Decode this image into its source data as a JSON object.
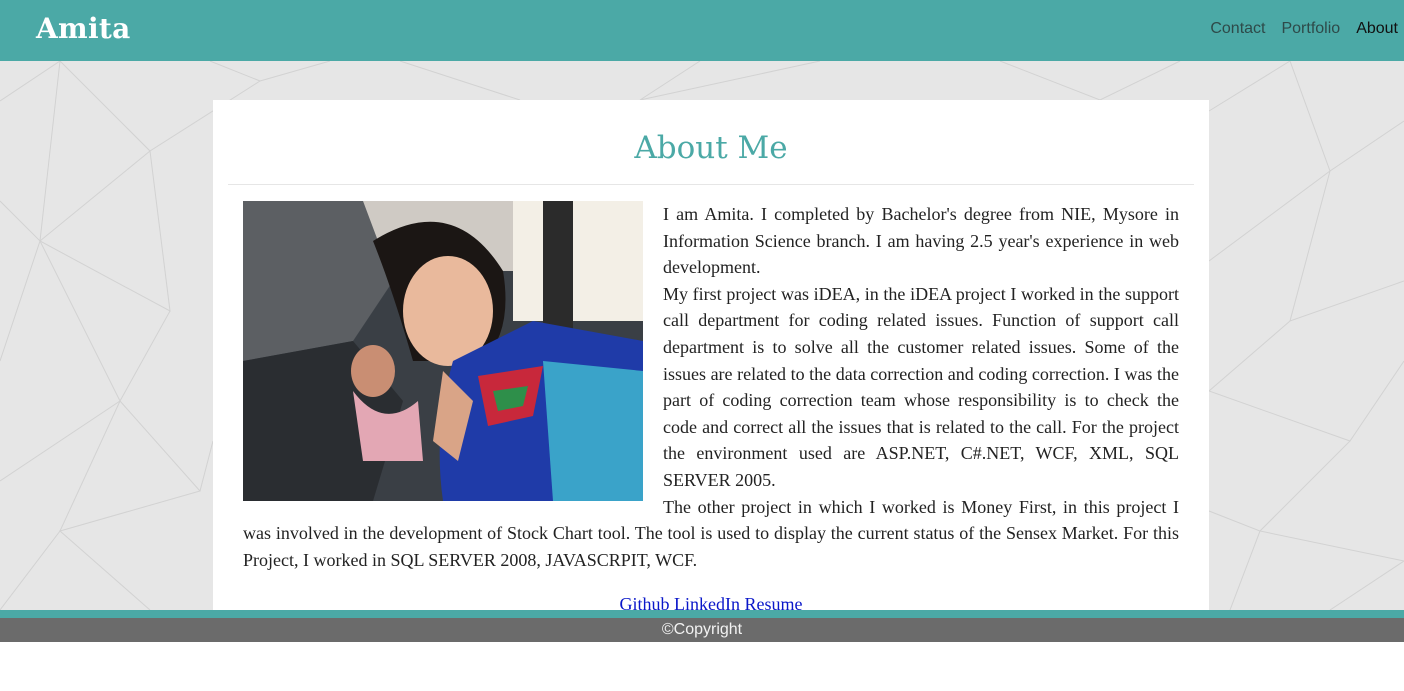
{
  "header": {
    "brand": "Amita",
    "nav": [
      {
        "label": "Contact"
      },
      {
        "label": "Portfolio"
      },
      {
        "label": "About"
      }
    ],
    "active_nav": "About"
  },
  "about": {
    "title": "About Me",
    "paragraphs": [
      "I am Amita. I completed by Bachelor's degree from NIE, Mysore in Information Science branch. I am having 2.5 year's experience in web development.",
      "My first project was iDEA, in the iDEA project I worked in the support call department for coding related issues. Function of support call department is to solve all the customer related issues. Some of the issues are related to the data correction and coding correction. I was the part of coding correction team whose responsibility is to check the code and correct all the issues that is related to the call. For the project the environment used are ASP.NET, C#.NET, WCF, XML, SQL SERVER 2005.",
      "The other project in which I worked is Money First, in this project I was involved in the development of Stock Chart tool. The tool is used to display the current status of the Sensex Market. For this Project, I worked in SQL SERVER 2008, JAVASCRPIT, WCF."
    ],
    "links": [
      {
        "label": "Github"
      },
      {
        "label": "LinkedIn"
      },
      {
        "label": "Resume"
      }
    ]
  },
  "footer": {
    "copyright": "©Copyright"
  },
  "colors": {
    "accent": "#4ba9a6",
    "link": "#0a17c9",
    "footer_bg": "#6b6b6b",
    "page_bg": "#e6e6e6"
  }
}
